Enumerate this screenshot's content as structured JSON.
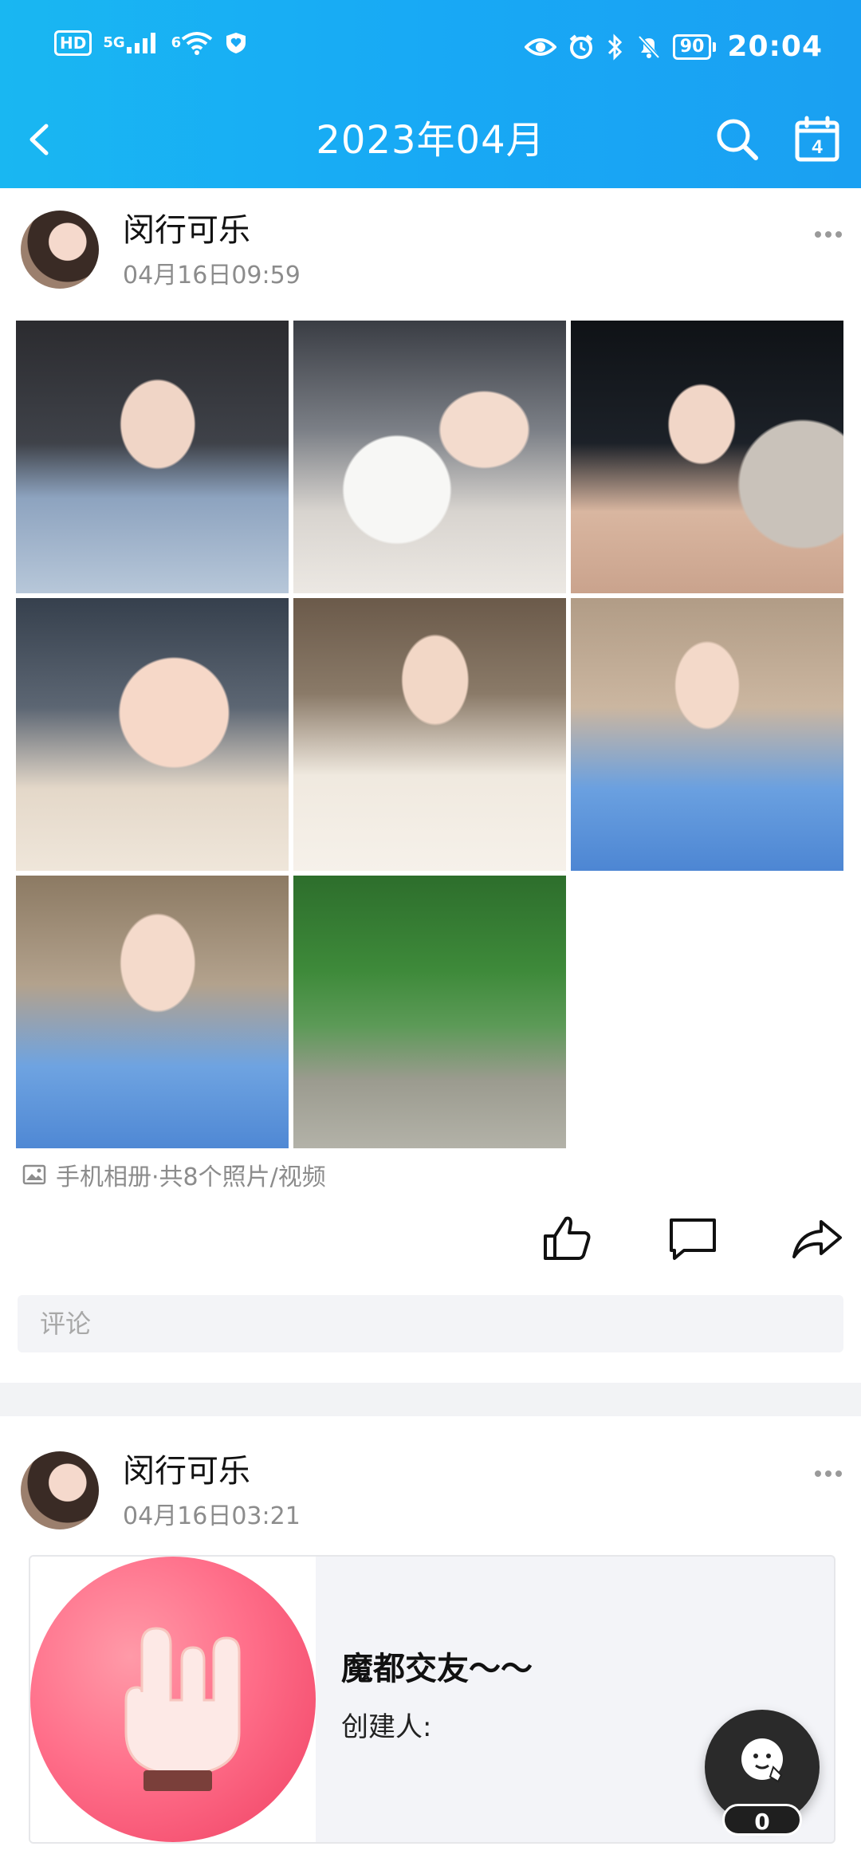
{
  "status_bar": {
    "left": {
      "hd": "HD",
      "signal_label": "5G",
      "wifi_label": "6"
    },
    "battery_level": "90",
    "time": "20:04"
  },
  "nav": {
    "title": "2023年04月",
    "calendar_day": "4",
    "icons": [
      "back-arrow-icon",
      "search-icon",
      "calendar-icon"
    ]
  },
  "posts": [
    {
      "author": "闵行可乐",
      "time": "04月16日09:59",
      "album_info": "手机相册·共8个照片/视频",
      "photos_count": 8,
      "comment_placeholder": "评论",
      "actions": [
        "like-icon",
        "comment-icon",
        "share-icon"
      ]
    },
    {
      "author": "闵行可乐",
      "time": "04月16日03:21",
      "shared": {
        "title": "魔都交友～～",
        "creator_label": "创建人:"
      }
    }
  ],
  "floating": {
    "count": "0"
  }
}
